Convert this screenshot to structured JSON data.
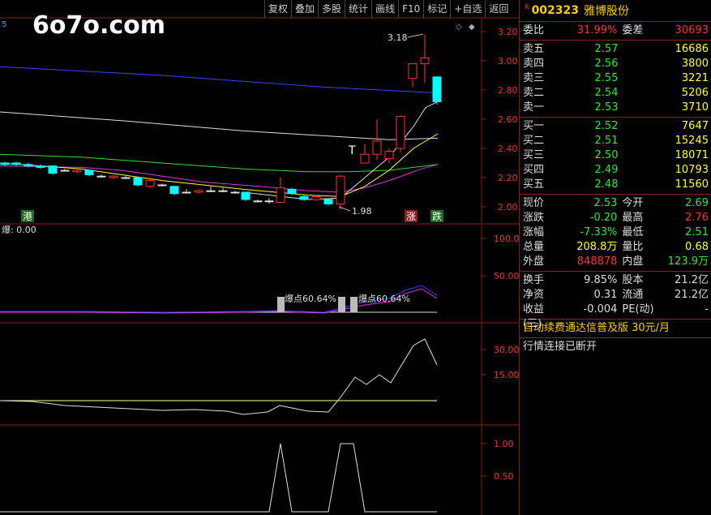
{
  "logo": "6o7o.com",
  "toolbar": [
    "复权",
    "叠加",
    "多股",
    "统计",
    "画线",
    "F10",
    "标记",
    "+自选",
    "返回"
  ],
  "main_axis": [
    "3.20",
    "3.00",
    "2.80",
    "2.60",
    "2.40",
    "2.20",
    "2.00"
  ],
  "labels": {
    "high_mark": "3.18",
    "low_mark": "1.98",
    "t_mark": "T",
    "gang": "港",
    "zhang": "涨",
    "die": "跌",
    "top_left": "5",
    "ind_title": "爆: 0.00",
    "bao1": "爆点60.64%",
    "bao2": "爆点60.64%"
  },
  "ind1_axis": [
    "100.0",
    "50.00"
  ],
  "ind2_axis": [
    "30.00",
    "15.00"
  ],
  "ind3_axis": [
    "1.00",
    "0.50"
  ],
  "stock": {
    "r": "R",
    "code": "002323",
    "name": "雅博股份"
  },
  "weibi": {
    "l1": "委比",
    "v1": "31.99%",
    "l2": "委差",
    "v2": "30693"
  },
  "asks": [
    {
      "label": "卖五",
      "price": "2.57",
      "vol": "16686"
    },
    {
      "label": "卖四",
      "price": "2.56",
      "vol": "3800"
    },
    {
      "label": "卖三",
      "price": "2.55",
      "vol": "3221"
    },
    {
      "label": "卖二",
      "price": "2.54",
      "vol": "5206"
    },
    {
      "label": "卖一",
      "price": "2.53",
      "vol": "3710"
    }
  ],
  "bids": [
    {
      "label": "买一",
      "price": "2.52",
      "vol": "7647"
    },
    {
      "label": "买二",
      "price": "2.51",
      "vol": "15245"
    },
    {
      "label": "买三",
      "price": "2.50",
      "vol": "18071"
    },
    {
      "label": "买四",
      "price": "2.49",
      "vol": "10793"
    },
    {
      "label": "买五",
      "price": "2.48",
      "vol": "11560"
    }
  ],
  "quote": [
    {
      "l1": "现价",
      "v1": "2.53",
      "c1": "green",
      "l2": "今开",
      "v2": "2.69",
      "c2": "green"
    },
    {
      "l1": "涨跌",
      "v1": "-0.20",
      "c1": "green",
      "l2": "最高",
      "v2": "2.76",
      "c2": "red"
    },
    {
      "l1": "涨幅",
      "v1": "-7.33%",
      "c1": "green",
      "l2": "最低",
      "v2": "2.51",
      "c2": "green"
    },
    {
      "l1": "总量",
      "v1": "208.8万",
      "c1": "yellow",
      "l2": "量比",
      "v2": "0.68",
      "c2": "yellow"
    },
    {
      "l1": "外盘",
      "v1": "848878",
      "c1": "red",
      "l2": "内盘",
      "v2": "123.9万",
      "c2": "green"
    }
  ],
  "fin": [
    {
      "l1": "换手",
      "v1": "9.85%",
      "l2": "股本",
      "v2": "21.2亿"
    },
    {
      "l1": "净资",
      "v1": "0.31",
      "l2": "流通",
      "v2": "21.2亿"
    },
    {
      "l1": "收益(三)",
      "v1": "-0.004",
      "l2": "PE(动)",
      "v2": "-"
    }
  ],
  "ad": "自动续费通达信普及版  30元/月",
  "status": "行情连接已断开",
  "colors": {
    "up": "#ff3333",
    "down": "#00ffff",
    "border": "#8a1c1c"
  }
}
